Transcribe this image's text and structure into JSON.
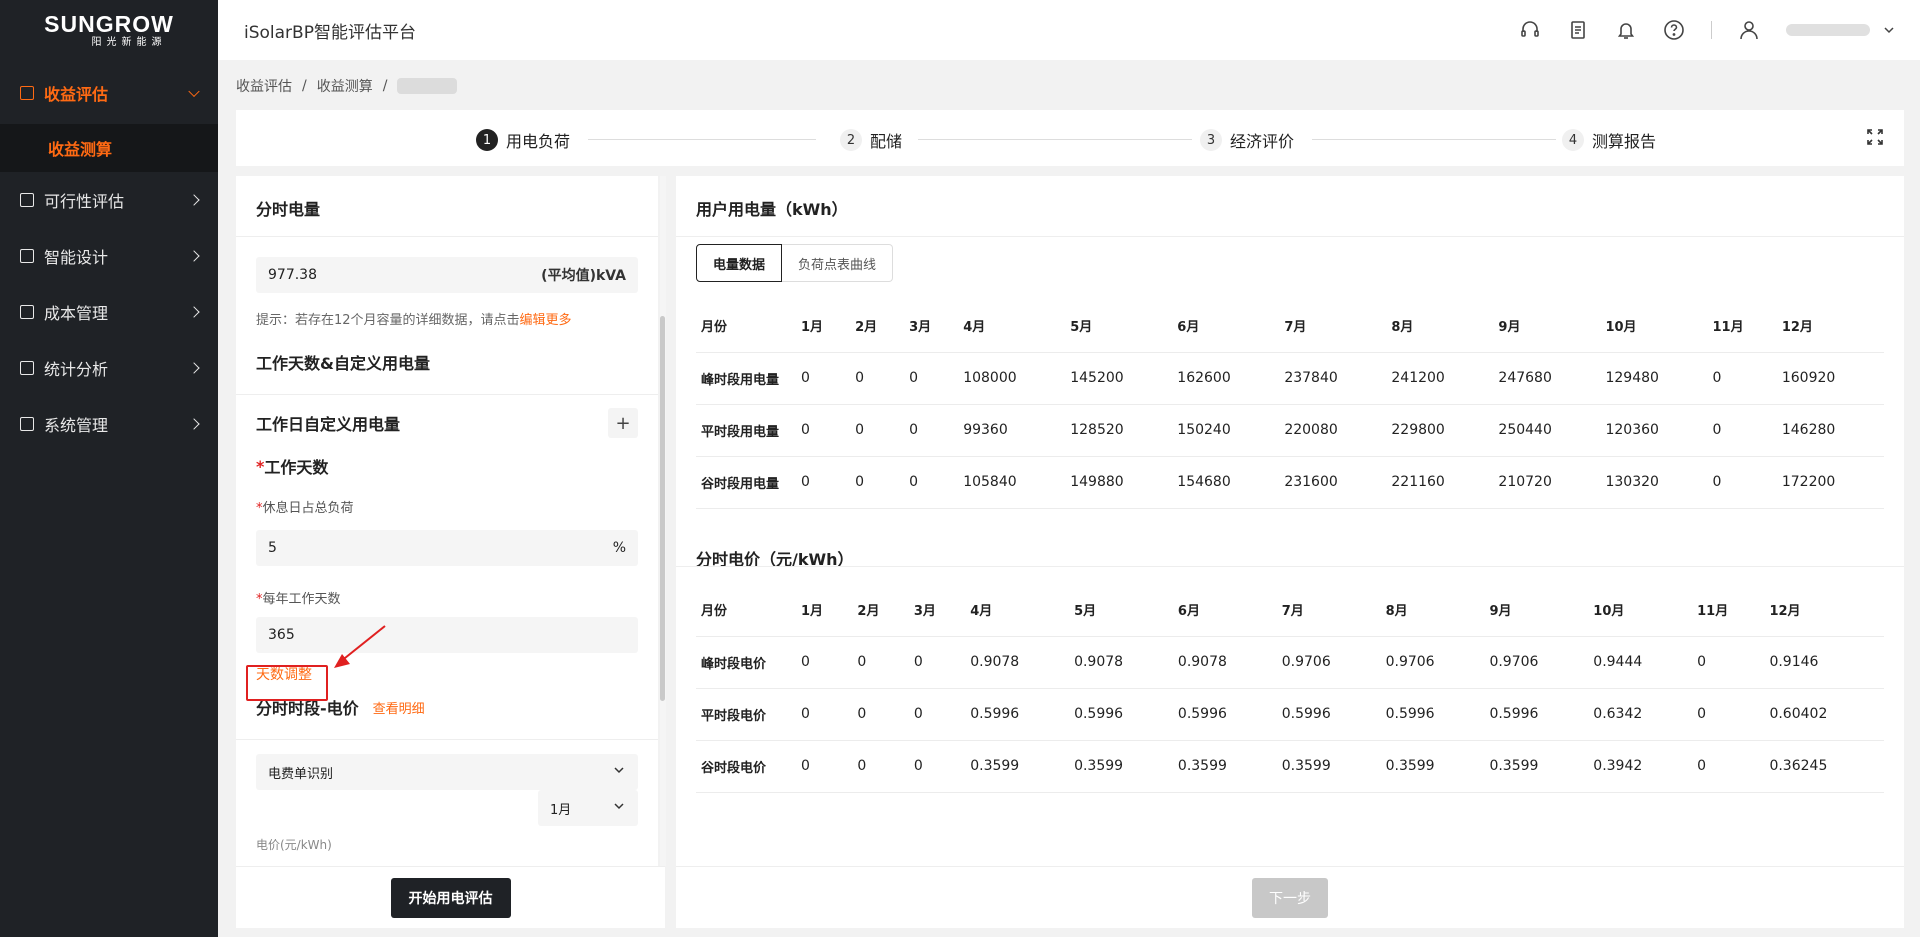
{
  "logo": {
    "main": "SUNGROW",
    "sub": "阳光新能源"
  },
  "sidebar": {
    "items": [
      {
        "label": "收益评估",
        "expanded": true,
        "sub": [
          {
            "label": "收益测算"
          }
        ]
      },
      {
        "label": "可行性评估"
      },
      {
        "label": "智能设计"
      },
      {
        "label": "成本管理"
      },
      {
        "label": "统计分析"
      },
      {
        "label": "系统管理"
      }
    ]
  },
  "header": {
    "title": "iSolarBP智能评估平台"
  },
  "breadcrumb": [
    "收益评估",
    "/",
    "收益测算",
    "/"
  ],
  "steps": [
    {
      "num": "1",
      "label": "用电负荷"
    },
    {
      "num": "2",
      "label": "配储"
    },
    {
      "num": "3",
      "label": "经济评价"
    },
    {
      "num": "4",
      "label": "测算报告"
    }
  ],
  "left": {
    "section1_title": "分时电量",
    "capacity_value": "977.38",
    "capacity_unit": "(平均值)kVA",
    "hint_text": "提示：若存在12个月容量的详细数据，请点击",
    "hint_link": "编辑更多",
    "section2_title": "工作天数&自定义用电量",
    "section3_title": "工作日自定义用电量",
    "plus": "+",
    "workdays_title": "工作天数",
    "rest_label": "休息日占总负荷",
    "rest_value": "5",
    "rest_unit": "%",
    "yearly_label": "每年工作天数",
    "yearly_value": "365",
    "adjust_link": "天数调整",
    "section4_title": "分时时段-电价",
    "detail_link": "查看明细",
    "bill_select": "电费单识别",
    "month_select": "1月",
    "price_unit_label": "电价(元/kWh)",
    "required_mark": "*",
    "start_button": "开始用电评估"
  },
  "right": {
    "title1": "用户用电量（kWh）",
    "tabs": [
      "电量数据",
      "负荷点表曲线"
    ],
    "title2": "分时电价（元/kWh）",
    "next_button": "下一步",
    "energy_table": {
      "headers": [
        "月份",
        "1月",
        "2月",
        "3月",
        "4月",
        "5月",
        "6月",
        "7月",
        "8月",
        "9月",
        "10月",
        "11月",
        "12月"
      ],
      "rows": [
        [
          "峰时段用电量",
          "0",
          "0",
          "0",
          "108000",
          "145200",
          "162600",
          "237840",
          "241200",
          "247680",
          "129480",
          "0",
          "160920"
        ],
        [
          "平时段用电量",
          "0",
          "0",
          "0",
          "99360",
          "128520",
          "150240",
          "220080",
          "229800",
          "250440",
          "120360",
          "0",
          "146280"
        ],
        [
          "谷时段用电量",
          "0",
          "0",
          "0",
          "105840",
          "149880",
          "154680",
          "231600",
          "221160",
          "210720",
          "130320",
          "0",
          "172200"
        ]
      ]
    },
    "price_table": {
      "headers": [
        "月份",
        "1月",
        "2月",
        "3月",
        "4月",
        "5月",
        "6月",
        "7月",
        "8月",
        "9月",
        "10月",
        "11月",
        "12月"
      ],
      "rows": [
        [
          "峰时段电价",
          "0",
          "0",
          "0",
          "0.9078",
          "0.9078",
          "0.9078",
          "0.9706",
          "0.9706",
          "0.9706",
          "0.9444",
          "0",
          "0.9146"
        ],
        [
          "平时段电价",
          "0",
          "0",
          "0",
          "0.5996",
          "0.5996",
          "0.5996",
          "0.5996",
          "0.5996",
          "0.5996",
          "0.6342",
          "0",
          "0.60402"
        ],
        [
          "谷时段电价",
          "0",
          "0",
          "0",
          "0.3599",
          "0.3599",
          "0.3599",
          "0.3599",
          "0.3599",
          "0.3599",
          "0.3942",
          "0",
          "0.36245"
        ]
      ]
    }
  },
  "colors": {
    "accent": "#ff6a13",
    "sidebar_bg": "#1f2226",
    "annotation_red": "#e02020"
  }
}
